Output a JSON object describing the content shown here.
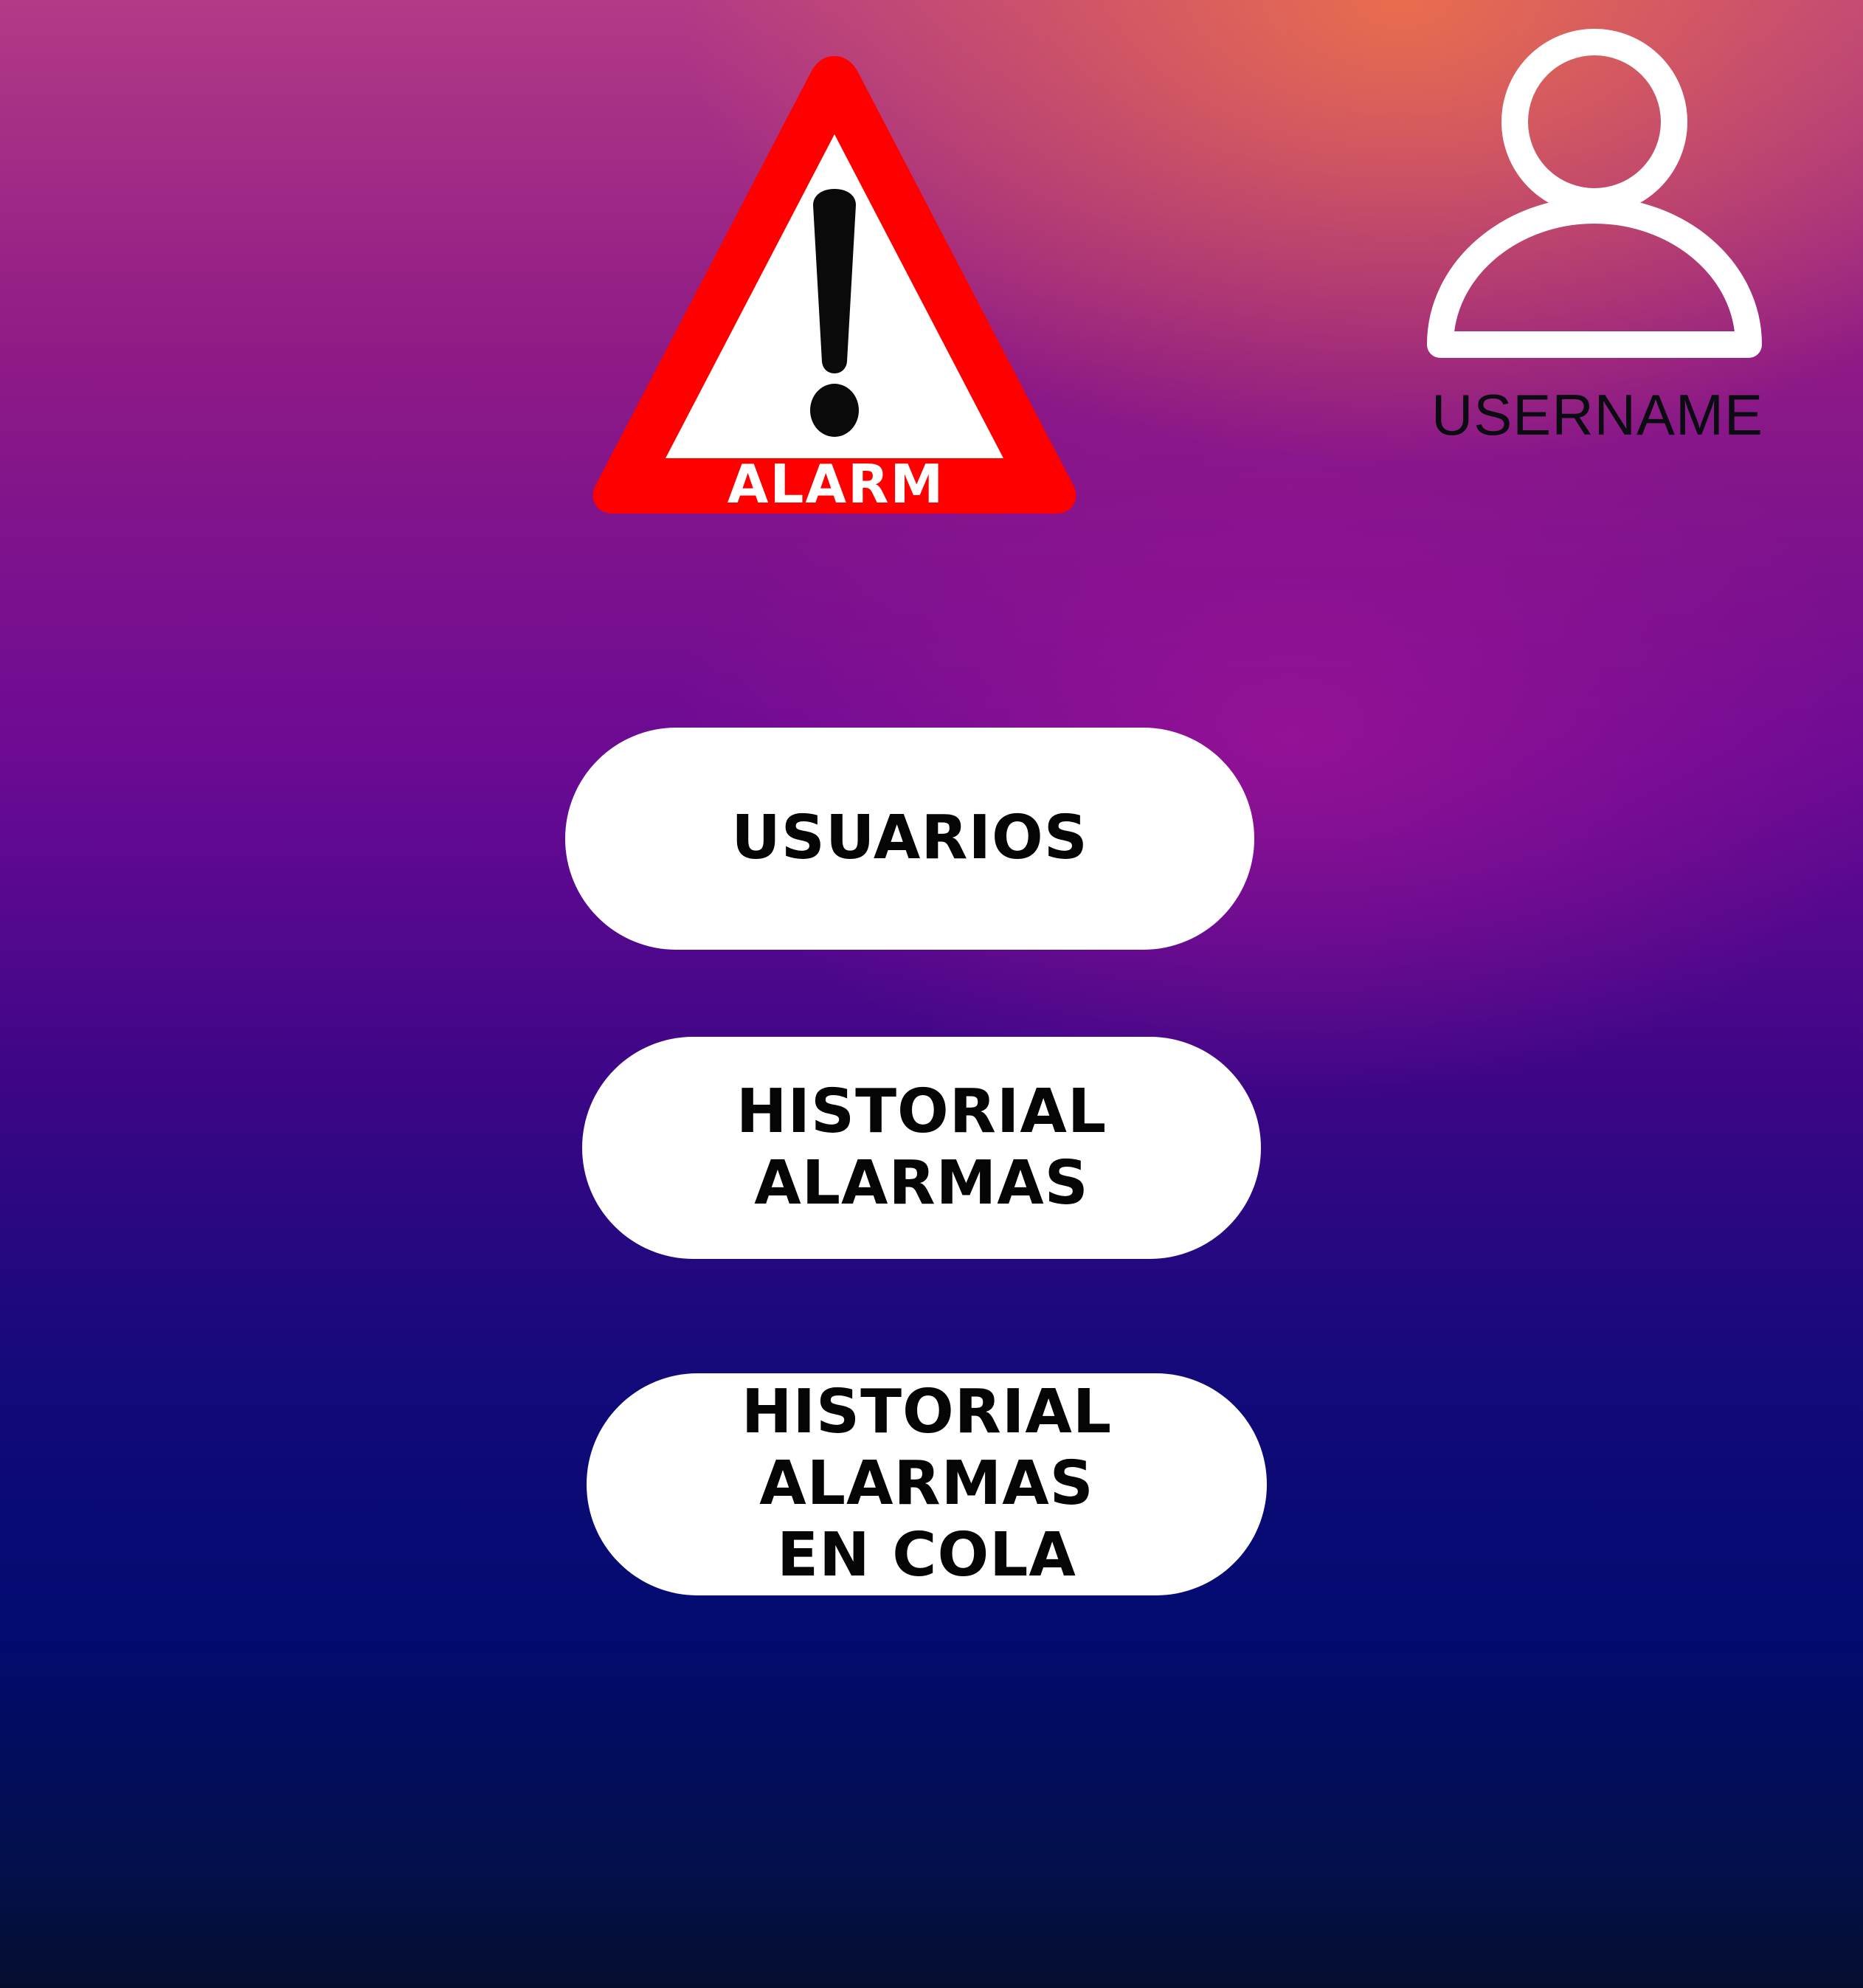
{
  "logo": {
    "label": "ALARM",
    "icon": "alarm-warning-triangle-icon",
    "colors": {
      "border": "#ff0000",
      "fill": "#ffffff",
      "exclamation": "#0a0a0a",
      "label": "#ffffff"
    }
  },
  "user": {
    "icon": "user-icon",
    "username": "USERNAME"
  },
  "menu": {
    "buttons": [
      {
        "label": "USUARIOS"
      },
      {
        "label": "HISTORIAL ALARMAS"
      },
      {
        "label": "HISTORIAL ALARMAS\nEN COLA"
      }
    ]
  }
}
